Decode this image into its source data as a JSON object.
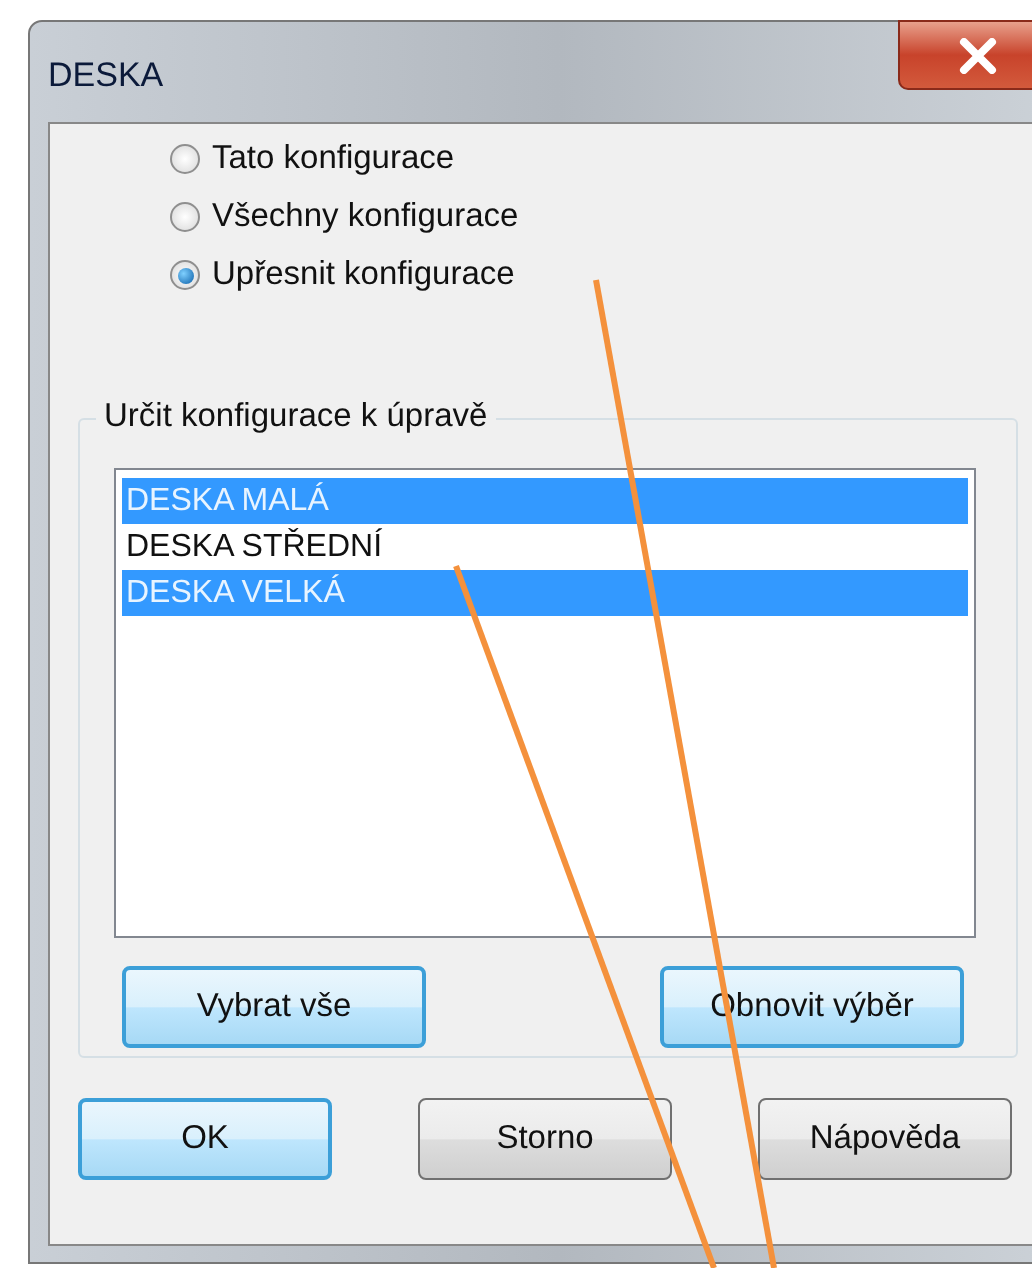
{
  "window": {
    "title": "DESKA"
  },
  "scope_options": [
    {
      "label": "Tato konfigurace",
      "selected": false
    },
    {
      "label": "Všechny konfigurace",
      "selected": false
    },
    {
      "label": "Upřesnit konfigurace",
      "selected": true
    }
  ],
  "group": {
    "title": "Určit konfigurace k úpravě",
    "items": [
      {
        "label": "DESKA MALÁ",
        "selected": true
      },
      {
        "label": "DESKA STŘEDNÍ",
        "selected": false
      },
      {
        "label": "DESKA VELKÁ",
        "selected": true
      }
    ],
    "buttons": [
      {
        "label": "Vybrat vše",
        "focused": true
      },
      {
        "label": "Obnovit výběr",
        "focused": true
      }
    ]
  },
  "buttons": [
    {
      "label": "OK",
      "focused": true
    },
    {
      "label": "Storno",
      "focused": false
    },
    {
      "label": "Nápověda",
      "focused": false
    }
  ]
}
